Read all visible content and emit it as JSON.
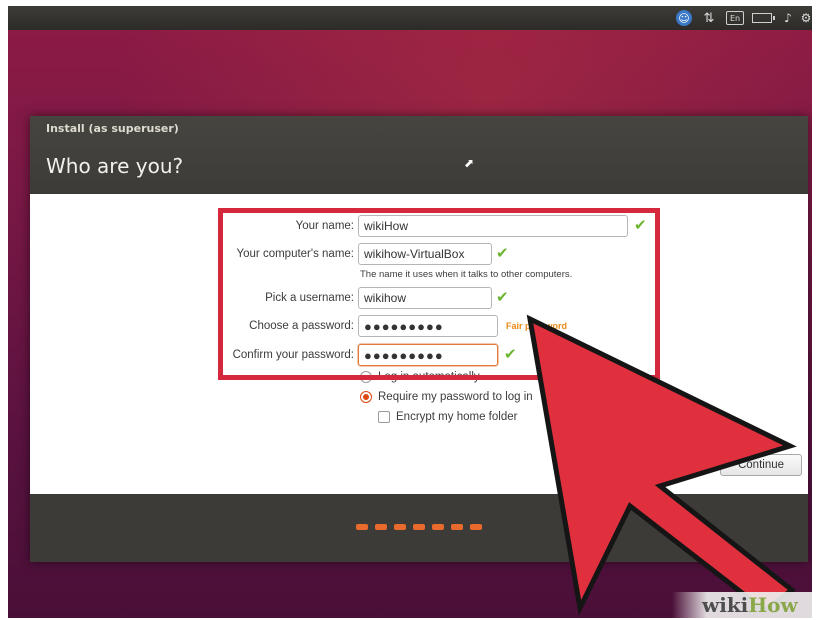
{
  "window": {
    "title": "Install (as superuser)",
    "heading": "Who are you?"
  },
  "form": {
    "your_name": {
      "label": "Your name:",
      "value": "wikiHow"
    },
    "computer_name": {
      "label": "Your computer's name:",
      "value": "wikihow-VirtualBox",
      "hint": "The name it uses when it talks to other computers."
    },
    "username": {
      "label": "Pick a username:",
      "value": "wikihow"
    },
    "password": {
      "label": "Choose a password:",
      "value": "●●●●●●●●●",
      "strength": "Fair password"
    },
    "confirm_password": {
      "label": "Confirm your password:",
      "value": "●●●●●●●●●"
    },
    "login_auto": {
      "label": "Log in automatically",
      "selected": false
    },
    "require_password": {
      "label": "Require my password to log in",
      "selected": true
    },
    "encrypt_home": {
      "label": "Encrypt my home folder",
      "checked": false
    }
  },
  "buttons": {
    "continue_label": "Continue"
  },
  "progress": {
    "total_steps": 7
  },
  "watermark": {
    "wiki": "wiki",
    "how": "How"
  },
  "colors": {
    "highlight": "#d6283c",
    "arrow": "#e0303e",
    "accent": "#dd4814",
    "check": "#6cb530",
    "strength": "#e98a16"
  }
}
